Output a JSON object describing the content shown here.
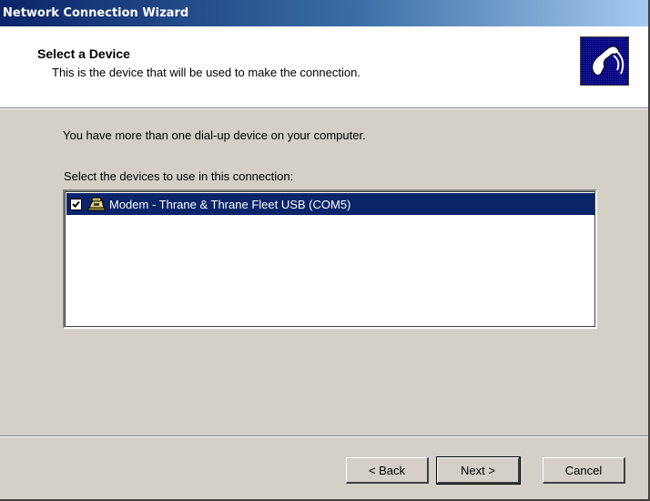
{
  "window": {
    "title": "Network Connection Wizard"
  },
  "header": {
    "title": "Select a Device",
    "subtitle": "This is the device that will be used to make the connection.",
    "icon": "phone-handset-icon"
  },
  "content": {
    "intro": "You have more than one dial-up device on your computer.",
    "list_label": "Select the devices to use in this connection:",
    "devices": [
      {
        "label": "Modem - Thrane & Thrane Fleet USB (COM5)",
        "checked": true,
        "selected": true,
        "icon": "modem-icon"
      }
    ]
  },
  "buttons": {
    "back": "< Back",
    "next": "Next >",
    "cancel": "Cancel"
  },
  "colors": {
    "selection": "#0a246a",
    "titlebar": "#0a246a",
    "face": "#d4d0c8"
  }
}
